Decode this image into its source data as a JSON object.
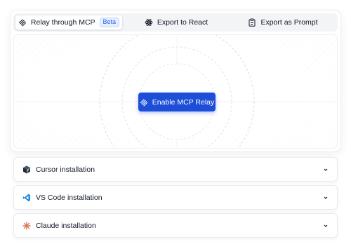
{
  "tabs": [
    {
      "label": "Relay through MCP",
      "icon": "relay-icon",
      "active": true,
      "badge": "Beta"
    },
    {
      "label": "Export to React",
      "icon": "react-icon",
      "active": false
    },
    {
      "label": "Export as Prompt",
      "icon": "clipboard-icon",
      "active": false
    }
  ],
  "relay_button": {
    "label": "Enable MCP Relay",
    "icon": "relay-icon",
    "color": "#1d4ed8"
  },
  "installations": [
    {
      "label": "Cursor installation",
      "icon": "cursor-logo-icon"
    },
    {
      "label": "VS Code installation",
      "icon": "vscode-logo-icon"
    },
    {
      "label": "Claude installation",
      "icon": "claude-logo-icon"
    }
  ],
  "colors": {
    "accent": "#1d4ed8",
    "badge": "#2563eb",
    "vscode": "#1e88e5",
    "claude": "#d97757"
  }
}
